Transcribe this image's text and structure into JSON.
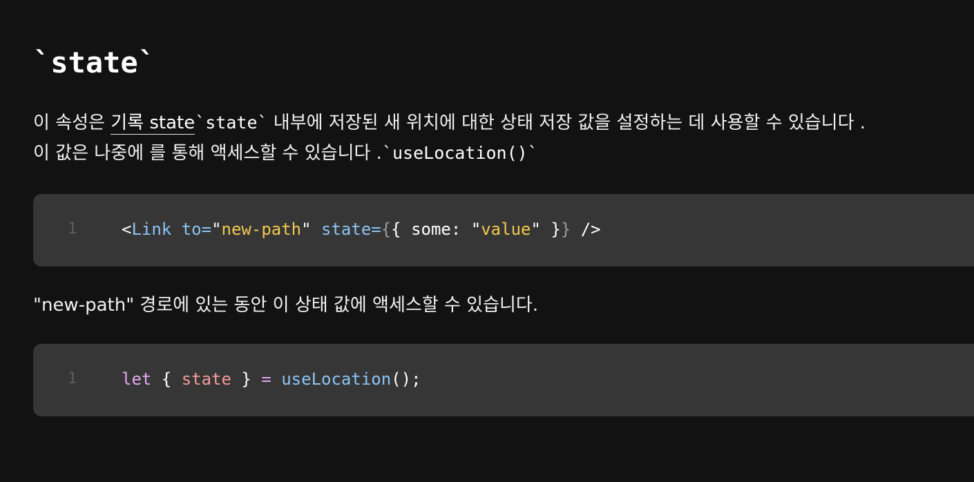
{
  "heading": "`state`",
  "paragraph1": {
    "text_before_link": "이 속성은 ",
    "link_text": "기록 state",
    "code1": "`state`",
    "text_after_code1": " 내부에 저장된 새 위치에 대한 상태 저장 값을 설정하는 데 사용할 수 있습니다 . 이 값은 나중에 를 통해 액세스할 수 있습니다 .",
    "code2": "`useLocation()`"
  },
  "code_block_1": {
    "line_number": "1",
    "tokens": {
      "open": "<",
      "tag": "Link",
      "attr1": "to",
      "eq1": "=",
      "str1_open": "\"",
      "str1": "new-path",
      "str1_close": "\"",
      "attr2": "state",
      "eq2": "=",
      "brace_open": "{",
      "obj_open": "{ some: \"",
      "str2": "value",
      "obj_close": "\" }",
      "brace_close": "}",
      "close": " />"
    }
  },
  "paragraph2": "\"new-path\" 경로에 있는 동안 이 상태 값에 액세스할 수 있습니다.",
  "code_block_2": {
    "line_number": "1",
    "tokens": {
      "kw": "let",
      "brace_open": " { ",
      "var": "state",
      "brace_close": " } ",
      "op": "=",
      "fn": " useLocation",
      "call": "();"
    }
  }
}
